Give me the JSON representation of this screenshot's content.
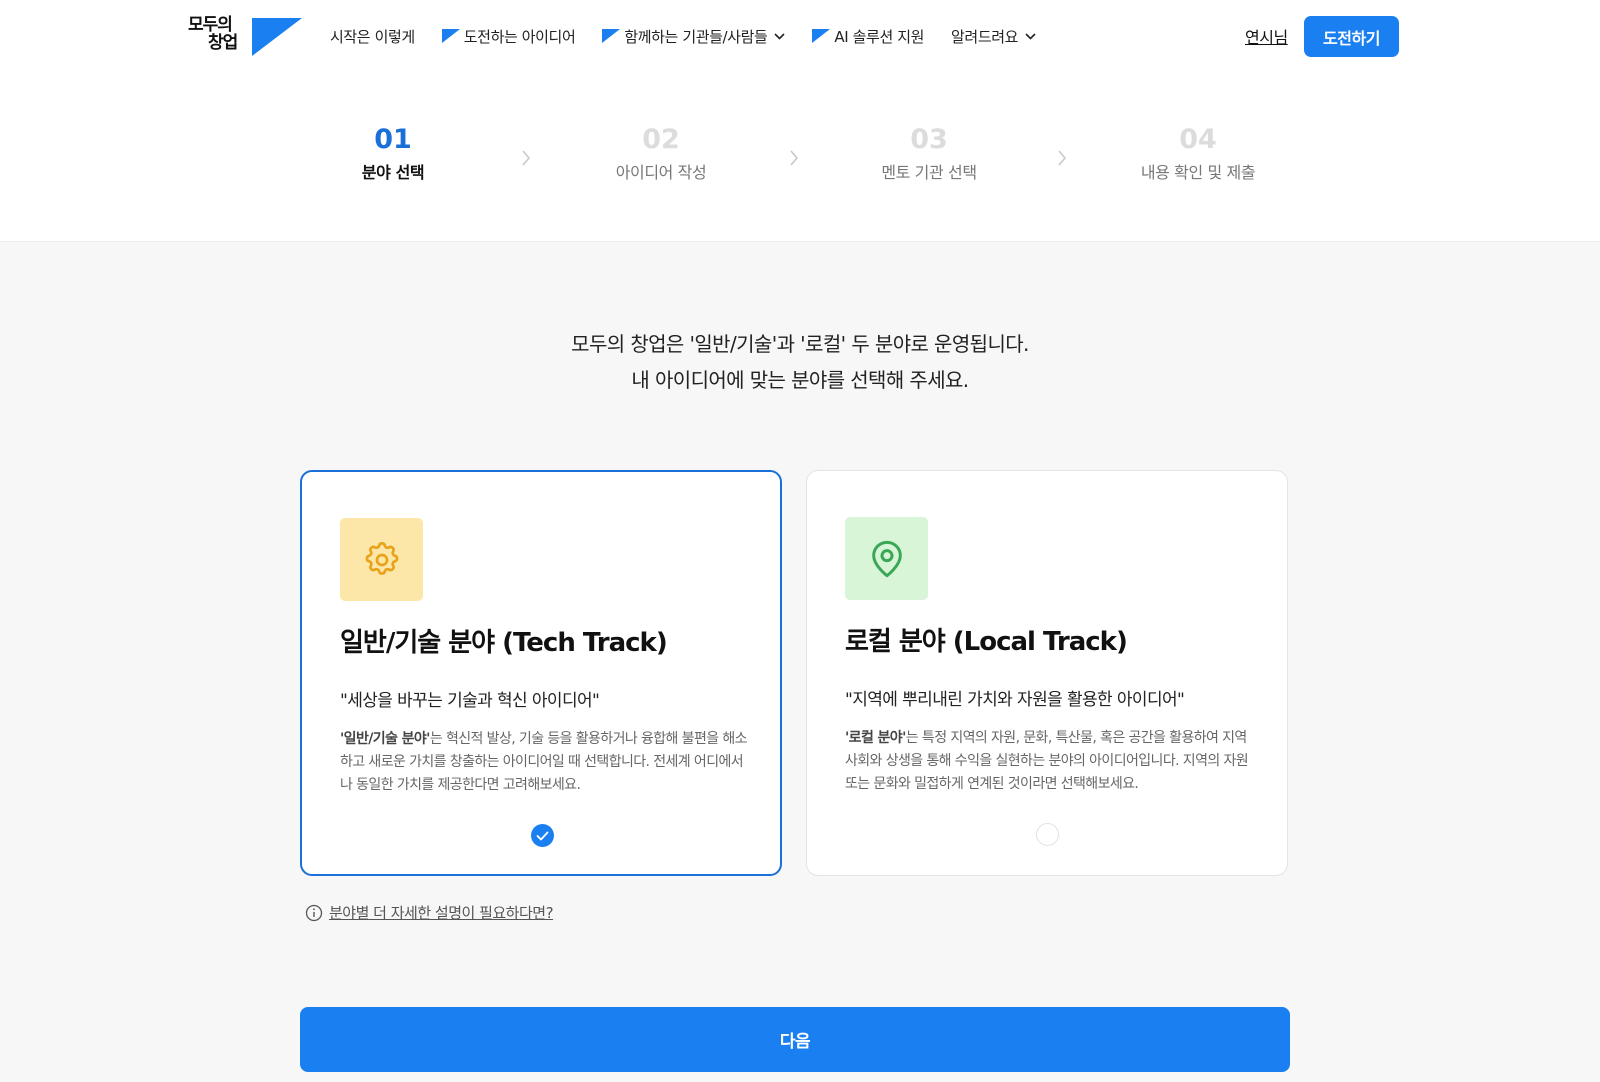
{
  "header": {
    "logo": {
      "line1": "모두의",
      "line2": "창업",
      "icon": "flag-logo-icon"
    },
    "nav": [
      {
        "label": "시작은 이렇게",
        "flag": false,
        "dropdown": false
      },
      {
        "label": "도전하는 아이디어",
        "flag": true,
        "dropdown": false
      },
      {
        "label": "함께하는 기관들/사람들",
        "flag": true,
        "dropdown": true
      },
      {
        "label": "AI 솔루션 지원",
        "flag": true,
        "dropdown": false
      },
      {
        "label": "알려드려요",
        "flag": false,
        "dropdown": true
      }
    ],
    "user_link": "연시님",
    "cta_label": "도전하기",
    "accent": "#1a7ff0"
  },
  "steps": [
    {
      "num": "01",
      "label": "분야 선택",
      "active": true
    },
    {
      "num": "02",
      "label": "아이디어 작성",
      "active": false
    },
    {
      "num": "03",
      "label": "멘토 기관 선택",
      "active": false
    },
    {
      "num": "04",
      "label": "내용 확인 및 제출",
      "active": false
    }
  ],
  "intro": {
    "line1": "모두의 창업은 '일반/기술'과 '로컬' 두 분야로 운영됩니다.",
    "line2": "내 아이디어에 맞는 분야를 선택해 주세요."
  },
  "cards": [
    {
      "icon": "gear-icon",
      "icon_bg": "#fde7a8",
      "icon_color": "#e8a31b",
      "title": "일반/기술 분야 (Tech Track)",
      "quote": "\"세상을 바꾸는 기술과 혁신 아이디어\"",
      "desc_bold": "'일반/기술 분야'",
      "desc": "는 혁신적 발상, 기술 등을 활용하거나 융합해 불편을 해소하고 새로운 가치를 창출하는 아이디어일 때 선택합니다. 전세계 어디에서나 동일한 가치를 제공한다면 고려해보세요.",
      "selected": true
    },
    {
      "icon": "map-pin-icon",
      "icon_bg": "#d8f5d8",
      "icon_color": "#3aa757",
      "title": "로컬 분야 (Local Track)",
      "quote": "\"지역에 뿌리내린 가치와 자원을 활용한 아이디어\"",
      "desc_bold": "'로컬 분야'",
      "desc": "는 특정 지역의 자원, 문화, 특산물, 혹은 공간을 활용하여 지역사회와 상생을 통해 수익을 실현하는 분야의 아이디어입니다. 지역의 자원 또는 문화와 밀접하게 연계된 것이라면 선택해보세요.",
      "selected": false
    }
  ],
  "help_link": "분야별 더 자세한 설명이 필요하다면?",
  "next_label": "다음"
}
